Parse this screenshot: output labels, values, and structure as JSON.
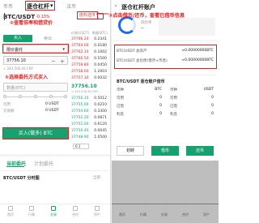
{
  "left": {
    "top_tabs": {
      "left_tab": "币币",
      "active_tab": "逐仓杠杆",
      "active_caret": "▾",
      "right_tab": "法币"
    },
    "pair": {
      "name": "BTC/USDT",
      "change": "-0.13%",
      "lever": "3X"
    },
    "buy_button": "买入",
    "sell_label": "卖出",
    "order_type": "限价委托",
    "order_type_caret": "▾",
    "anno_1": "①选择委托方式买入",
    "anno_2": "②查看倍率和借贷价",
    "anno_3": "③点击借币/还币，查看已借币信息",
    "price_input": "37756.10",
    "minus": "－",
    "plus": "＋",
    "cny_hint": "≈ 243,506.40 CNY",
    "amount_placeholder": "数量(BTC)",
    "avail_label": "可用",
    "avail_value": "0 USDT",
    "total_label": "交易额",
    "total_value": "0 USDT",
    "borrow_tag": "借币/还币",
    "big_buy_button": "买入(做多) BTC",
    "order_header": {
      "col1": "价格(USDT)",
      "col2": "数量(BTC)"
    },
    "sell_orders": [
      {
        "price": "37766.20",
        "qty": "0.2341"
      },
      {
        "price": "37764.00",
        "qty": "0.0180"
      },
      {
        "price": "37762.10",
        "qty": "0.1002"
      },
      {
        "price": "37760.50",
        "qty": "0.5500"
      },
      {
        "price": "37759.80",
        "qty": "0.0450"
      },
      {
        "price": "37758.00",
        "qty": "1.2003"
      },
      {
        "price": "37757.30",
        "qty": "0.0032"
      }
    ],
    "last_price": "37756.10",
    "last_price_cny": "≈ 243,506.40 CNY",
    "buy_orders": [
      {
        "price": "37756.10",
        "qty": "0.5012"
      },
      {
        "price": "37755.00",
        "qty": "0.0210"
      },
      {
        "price": "37754.60",
        "qty": "0.3300"
      },
      {
        "price": "37752.20",
        "qty": "0.0871"
      },
      {
        "price": "37751.00",
        "qty": "0.6120"
      },
      {
        "price": "37750.40",
        "qty": "0.0045"
      },
      {
        "price": "37748.90",
        "qty": "1.0500"
      }
    ],
    "depth_select": "0.1",
    "tabs": {
      "current": "当前委托",
      "plan": "计划委托"
    },
    "section_title": "BTC/USDT 分时图",
    "all_label": "全部",
    "nav": [
      "首页",
      "行情",
      "交易",
      "合约",
      "资产"
    ]
  },
  "right": {
    "title": "逐仓杠杆账户",
    "risk_label": "风险率",
    "risk_value": "--",
    "assets_title": "BTC/USDT 总资产",
    "rows_a": [
      {
        "k": "BTC/USDT 总资产",
        "v": "≈0.00000000BTC"
      },
      {
        "k": "BTC/USDT 总负债(借币+币息)",
        "v": "≈0.00000000BTC"
      }
    ],
    "section2": "BTC/USDT 逐仓账户借币",
    "rows_b": [
      {
        "k": "币种",
        "v": "BTC"
      },
      {
        "k": "可用",
        "v": "0"
      },
      {
        "k": "已借",
        "v": "0"
      },
      {
        "k": "利息",
        "v": "0"
      }
    ],
    "rows_c": [
      {
        "k": "币种",
        "v": "USDT"
      },
      {
        "k": "可用",
        "v": "0"
      },
      {
        "k": "已借",
        "v": "0"
      },
      {
        "k": "利息",
        "v": "0"
      }
    ],
    "btn_transfer": "划转",
    "btn_borrow": "借币",
    "btn_repay": "还币",
    "nav": [
      "首页",
      "行情",
      "交易",
      "合约",
      "资产"
    ]
  },
  "colors": {
    "green": "#17a070",
    "red": "#e02020",
    "blue": "#1f6bf0"
  }
}
